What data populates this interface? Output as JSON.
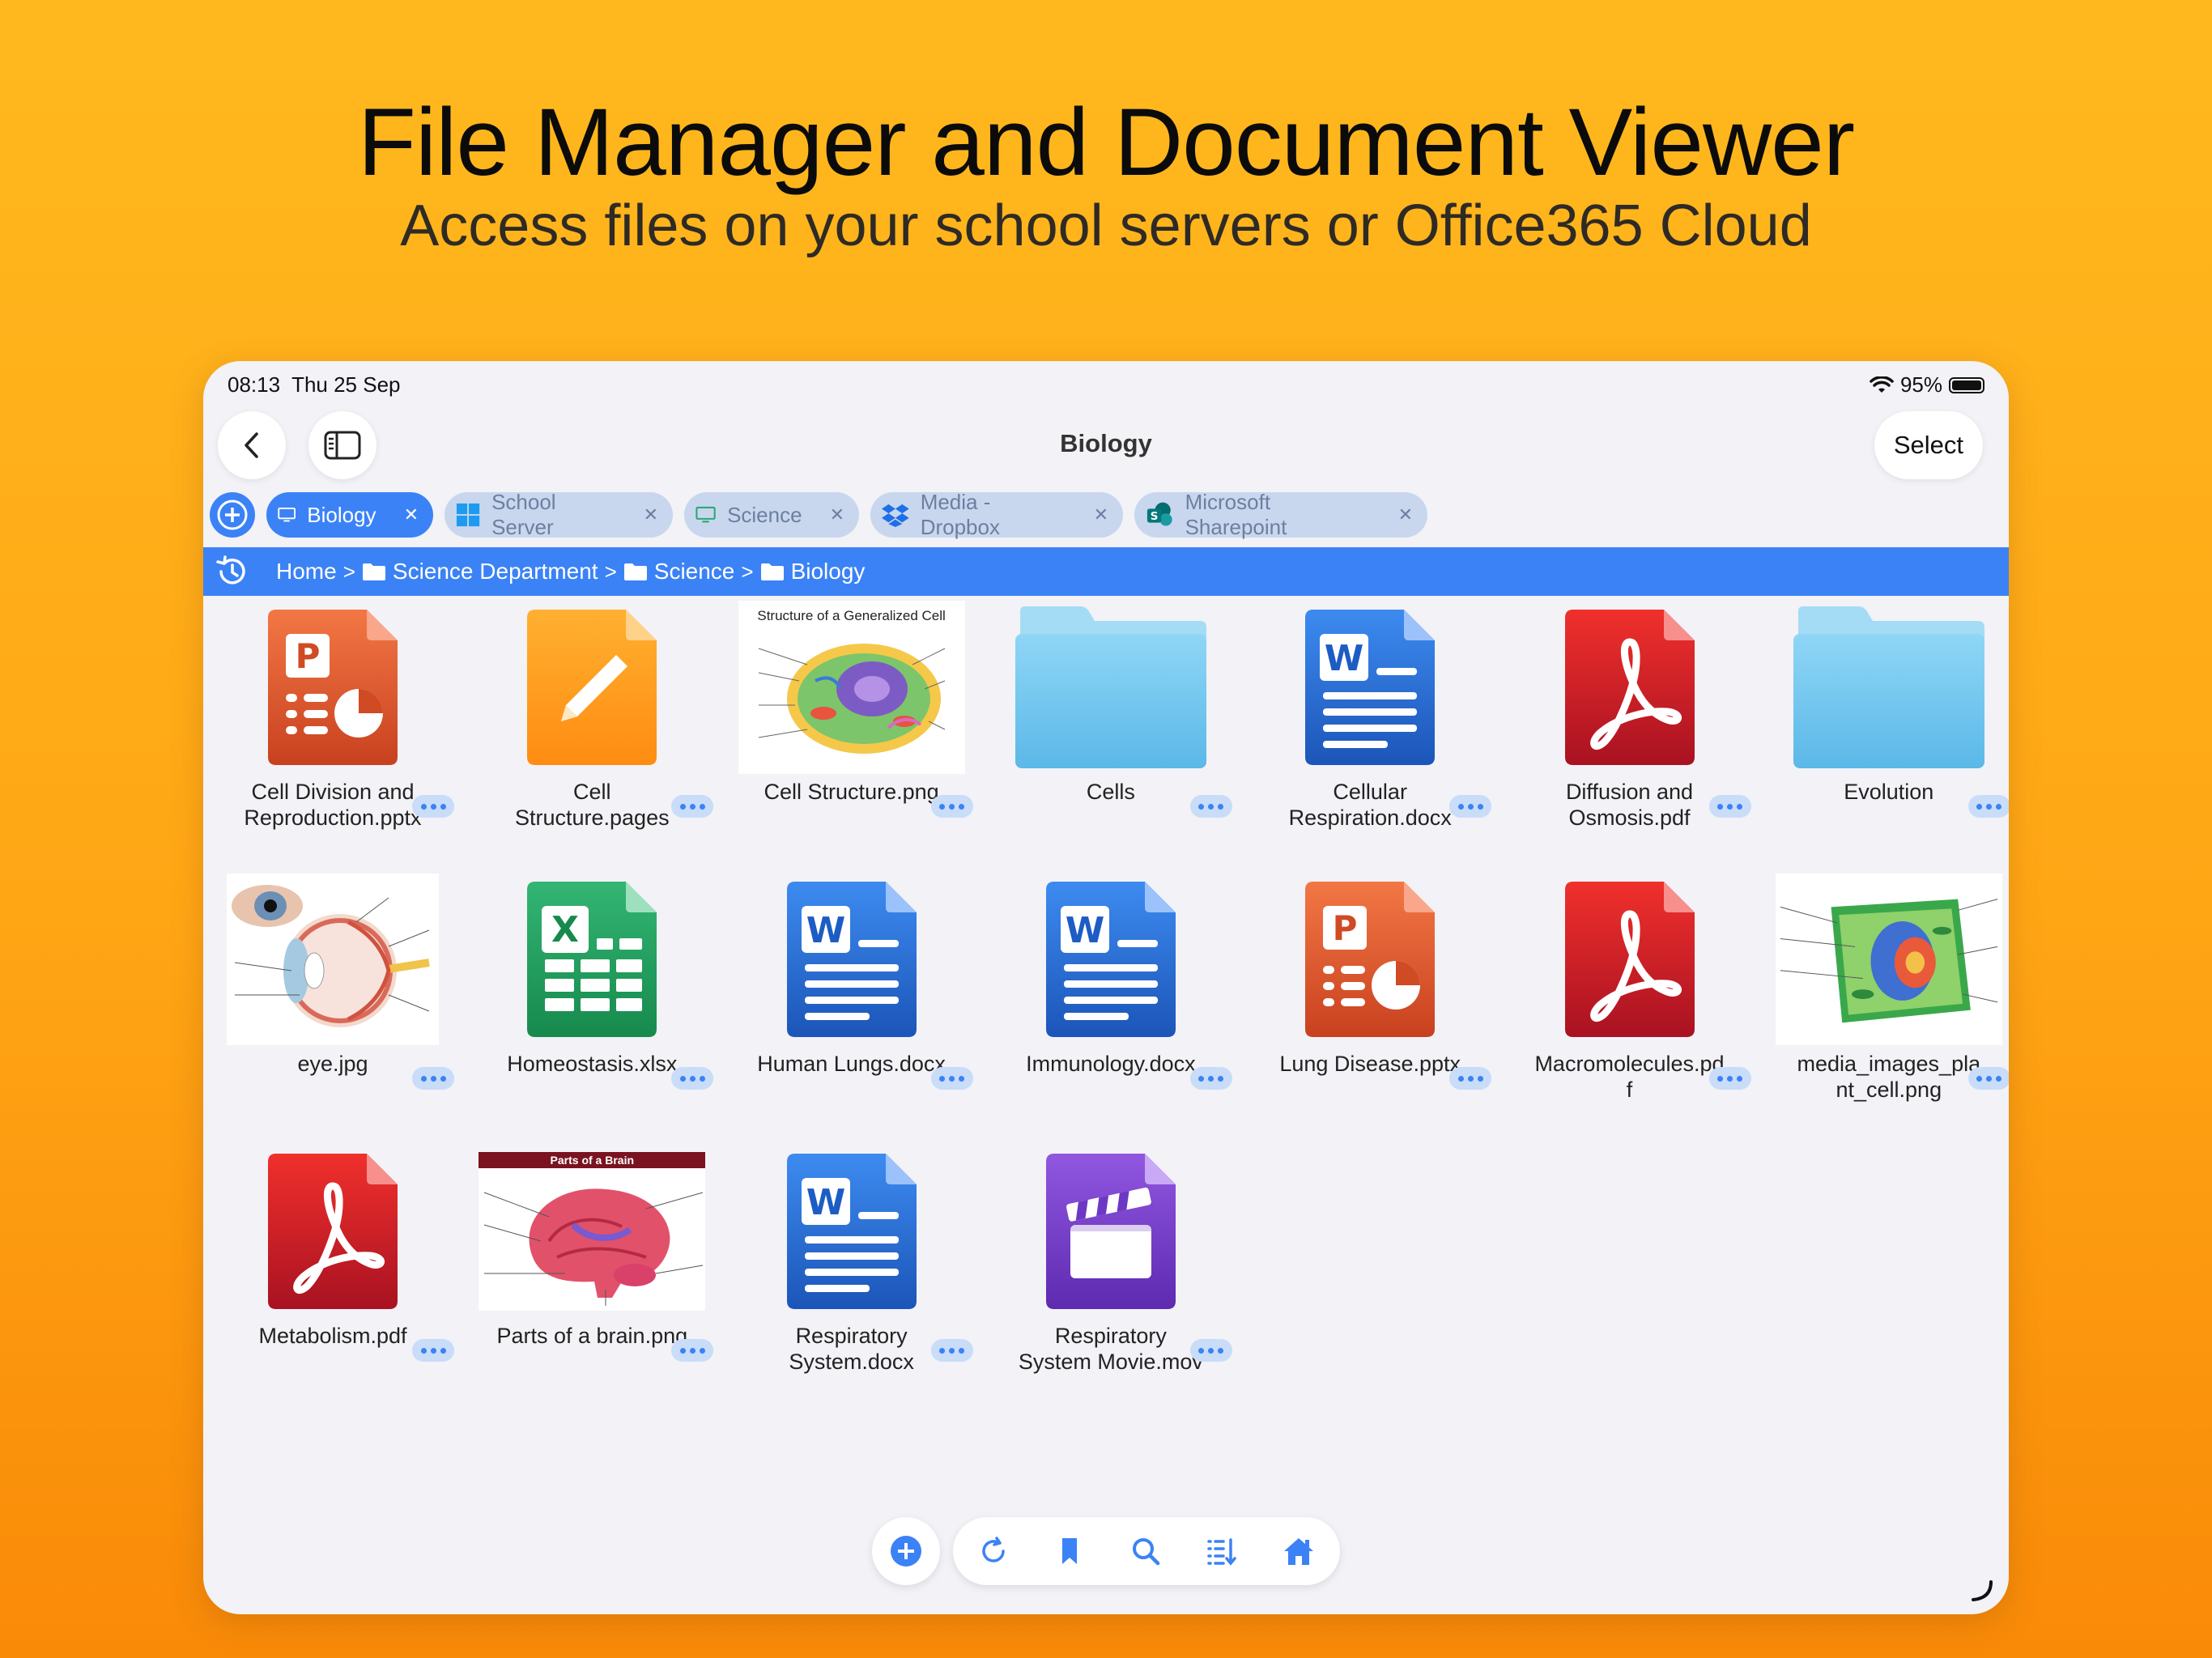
{
  "hero": {
    "title": "File Manager and Document Viewer",
    "subtitle": "Access files on your school servers or Office365 Cloud"
  },
  "status": {
    "time": "08:13",
    "date": "Thu 25 Sep",
    "battery": "95%"
  },
  "nav": {
    "title": "Biology",
    "select_label": "Select"
  },
  "tabs": [
    {
      "label": "Biology",
      "icon": "monitor-icon"
    },
    {
      "label": "School Server",
      "icon": "windows-icon"
    },
    {
      "label": "Science",
      "icon": "monitor-icon"
    },
    {
      "label": "Media - Dropbox",
      "icon": "dropbox-icon"
    },
    {
      "label": "Microsoft Sharepoint",
      "icon": "sharepoint-icon"
    }
  ],
  "breadcrumb": [
    "Home",
    "Science Department",
    "Science",
    "Biology"
  ],
  "files": [
    {
      "name": "Cell Division and Reproduction.pptx",
      "line1": "Cell Division and",
      "line2": "Reproduction.pptx",
      "type": "pptx"
    },
    {
      "name": "Cell Structure.pages",
      "line1": "Cell",
      "line2": "Structure.pages",
      "type": "pages"
    },
    {
      "name": "Cell Structure.png",
      "line1": "Cell Structure.png",
      "line2": "",
      "type": "image-cell",
      "caption": "Structure of a Generalized Cell"
    },
    {
      "name": "Cells",
      "line1": "Cells",
      "line2": "",
      "type": "folder"
    },
    {
      "name": "Cellular Respiration.docx",
      "line1": "Cellular",
      "line2": "Respiration.docx",
      "type": "docx"
    },
    {
      "name": "Diffusion and Osmosis.pdf",
      "line1": "Diffusion and",
      "line2": "Osmosis.pdf",
      "type": "pdf"
    },
    {
      "name": "Evolution",
      "line1": "Evolution",
      "line2": "",
      "type": "folder"
    },
    {
      "name": "eye.jpg",
      "line1": "eye.jpg",
      "line2": "",
      "type": "image-eye"
    },
    {
      "name": "Homeostasis.xlsx",
      "line1": "Homeostasis.xlsx",
      "line2": "",
      "type": "xlsx"
    },
    {
      "name": "Human Lungs.docx",
      "line1": "Human Lungs.docx",
      "line2": "",
      "type": "docx"
    },
    {
      "name": "Immunology.docx",
      "line1": "Immunology.docx",
      "line2": "",
      "type": "docx"
    },
    {
      "name": "Lung Disease.pptx",
      "line1": "Lung Disease.pptx",
      "line2": "",
      "type": "pptx"
    },
    {
      "name": "Macromolecules.pdf",
      "line1": "Macromolecules.pd",
      "line2": "f",
      "type": "pdf"
    },
    {
      "name": "media_images_plant_cell.png",
      "line1": "media_images_pla",
      "line2": "nt_cell.png",
      "type": "image-plant"
    },
    {
      "name": "Metabolism.pdf",
      "line1": "Metabolism.pdf",
      "line2": "",
      "type": "pdf"
    },
    {
      "name": "Parts of a brain.png",
      "line1": "Parts of a brain.png",
      "line2": "",
      "type": "image-brain",
      "caption": "Parts of a Brain"
    },
    {
      "name": "Respiratory System.docx",
      "line1": "Respiratory",
      "line2": "System.docx",
      "type": "docx"
    },
    {
      "name": "Respiratory System Movie.mov",
      "line1": "Respiratory",
      "line2": "System Movie.mov",
      "type": "mov"
    }
  ],
  "toolbar": [
    "add-icon",
    "refresh-icon",
    "bookmark-icon",
    "search-icon",
    "sort-icon",
    "home-icon"
  ],
  "colors": {
    "accent": "#3b82f6",
    "pdf": "#d81f26",
    "word": "#2f6fd8",
    "excel": "#21a366",
    "powerpoint": "#e0532c",
    "pages": "#ff9f1a",
    "folder": "#6fc4ec",
    "video": "#7a46cf"
  }
}
